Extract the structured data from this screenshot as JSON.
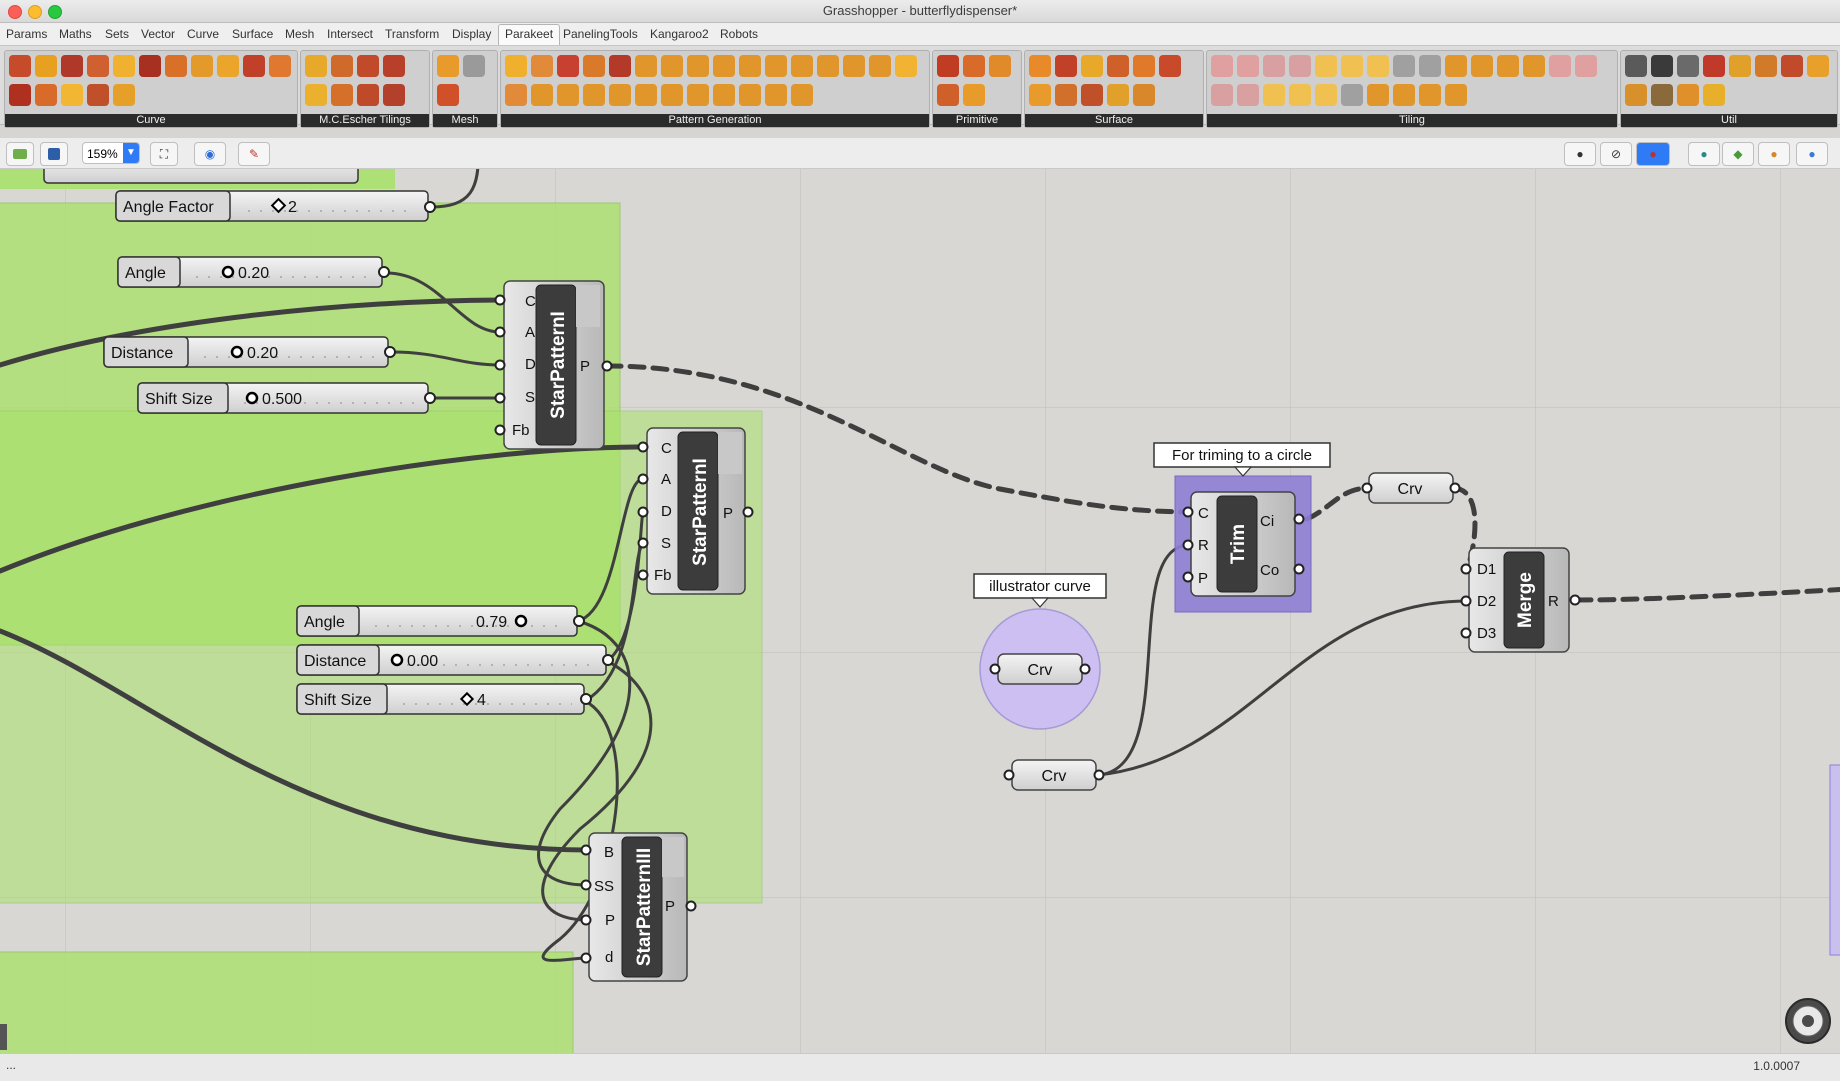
{
  "window": {
    "title": "Grasshopper - butterflydispenser*"
  },
  "menu": [
    {
      "label": "Params",
      "active": false
    },
    {
      "label": "Maths",
      "active": false
    },
    {
      "label": "Sets",
      "active": false
    },
    {
      "label": "Vector",
      "active": false
    },
    {
      "label": "Curve",
      "active": false
    },
    {
      "label": "Surface",
      "active": false
    },
    {
      "label": "Mesh",
      "active": false
    },
    {
      "label": "Intersect",
      "active": false
    },
    {
      "label": "Transform",
      "active": false
    },
    {
      "label": "Display",
      "active": false
    },
    {
      "label": "Parakeet",
      "active": true
    },
    {
      "label": "PanelingTools",
      "active": false
    },
    {
      "label": "Kangaroo2",
      "active": false
    },
    {
      "label": "Robots",
      "active": false
    }
  ],
  "ribbon_groups": [
    {
      "label": "Curve"
    },
    {
      "label": "M.C.Escher Tilings"
    },
    {
      "label": "Mesh"
    },
    {
      "label": "Pattern Generation"
    },
    {
      "label": "Primitive"
    },
    {
      "label": "Surface"
    },
    {
      "label": "Tiling"
    },
    {
      "label": "Util"
    }
  ],
  "toolbar": {
    "zoom": "159%"
  },
  "canvas": {
    "sliders": [
      {
        "name": "Angle Factor",
        "value": "2",
        "marker": "diamond"
      },
      {
        "name": "Angle",
        "value": "0.20",
        "marker": "circle"
      },
      {
        "name": "Distance",
        "value": "0.20",
        "marker": "circle"
      },
      {
        "name": "Shift Size",
        "value": "0.500",
        "marker": "circle"
      },
      {
        "name": "Angle",
        "value": "0.79",
        "marker": "circle"
      },
      {
        "name": "Distance",
        "value": "0.00",
        "marker": "circle"
      },
      {
        "name": "Shift Size",
        "value": "4",
        "marker": "diamond"
      }
    ],
    "components": [
      {
        "name": "StarPatternI",
        "inputs": [
          "C",
          "A",
          "D",
          "S",
          "Fb"
        ],
        "outputs": [
          "P"
        ]
      },
      {
        "name": "StarPatternI",
        "inputs": [
          "C",
          "A",
          "D",
          "S",
          "Fb"
        ],
        "outputs": [
          "P"
        ]
      },
      {
        "name": "StarPatternIII",
        "inputs": [
          "B",
          "SS",
          "P",
          "d"
        ],
        "outputs": [
          "P"
        ]
      },
      {
        "name": "Trim",
        "inputs": [
          "C",
          "R",
          "P"
        ],
        "outputs": [
          "Ci",
          "Co"
        ]
      },
      {
        "name": "Merge",
        "inputs": [
          "D1",
          "D2",
          "D3"
        ],
        "outputs": [
          "R"
        ]
      }
    ],
    "params": [
      {
        "label": "Crv"
      },
      {
        "label": "Crv"
      },
      {
        "label": "Crv"
      }
    ],
    "tooltips": [
      {
        "text": "For triming to a circle"
      },
      {
        "text": "illustrator curve"
      }
    ]
  },
  "status": {
    "left": "...",
    "right": "1.0.0007"
  },
  "colors": {
    "group_green": "#a9e26a",
    "cluster_purple": "#8f7fd6",
    "canvas_bg": "#d8d7d3"
  }
}
